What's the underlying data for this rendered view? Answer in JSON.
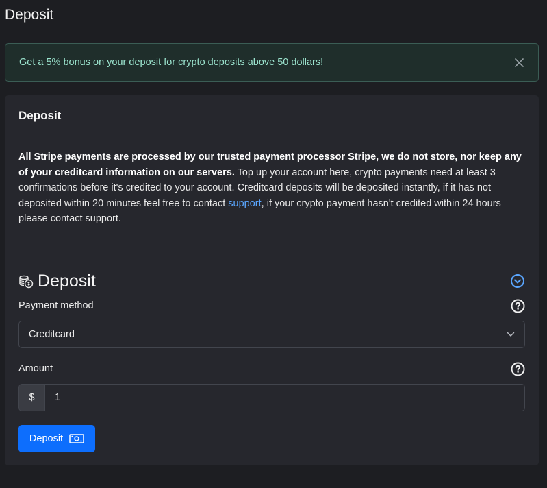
{
  "page": {
    "title": "Deposit"
  },
  "alert": {
    "text": "Get a 5% bonus on your deposit for crypto deposits above 50 dollars!"
  },
  "card": {
    "header": "Deposit",
    "info": {
      "bold": "All Stripe payments are processed by our trusted payment processor Stripe, we do not store, nor keep any of your creditcard information on our servers.",
      "text_before_link": " Top up your account here, crypto payments need at least 3 confirmations before it's credited to your account. Creditcard deposits will be deposited instantly, if it has not deposited within 20 minutes feel free to contact ",
      "link": "support",
      "text_after_link": ", if your crypto payment hasn't credited within 24 hours please contact support."
    }
  },
  "form": {
    "title": "Deposit",
    "payment_method_label": "Payment method",
    "payment_method_value": "Creditcard",
    "amount_label": "Amount",
    "currency_prefix": "$",
    "amount_value": "1",
    "submit_label": "Deposit"
  },
  "colors": {
    "accent": "#0d6efd",
    "link": "#5aa6ff",
    "alert_text": "#9ce5cf",
    "alert_bg": "#1f2e2b"
  },
  "icons": {
    "alert_close": "close-icon",
    "section": "coins-icon",
    "collapse": "chevron-down-circle-icon",
    "help": "question-circle-icon",
    "select": "chevron-down-icon",
    "button": "cash-icon"
  }
}
